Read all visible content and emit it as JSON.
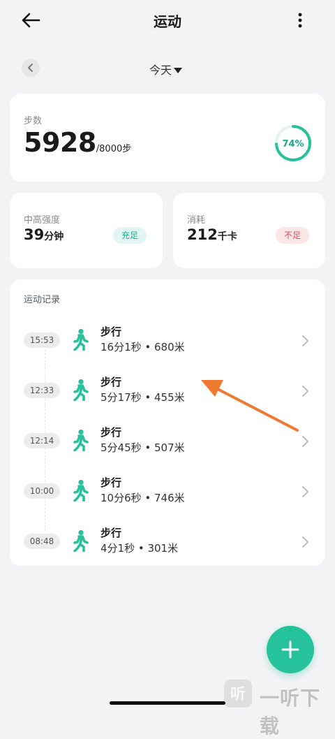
{
  "header": {
    "title": "运动"
  },
  "date": {
    "label": "今天"
  },
  "steps": {
    "label": "步数",
    "value": "5928",
    "goal": "/8000步",
    "percent_label": "74%",
    "percent": 0.74
  },
  "intensity": {
    "label": "中高强度",
    "value": "39",
    "unit": "分钟",
    "badge": "充足"
  },
  "energy": {
    "label": "消耗",
    "value": "212",
    "unit": "千卡",
    "badge": "不足"
  },
  "records": {
    "title": "运动记录",
    "items": [
      {
        "time": "15:53",
        "name": "步行",
        "detail": "16分1秒 • 680米"
      },
      {
        "time": "12:33",
        "name": "步行",
        "detail": "5分17秒 • 455米"
      },
      {
        "time": "12:14",
        "name": "步行",
        "detail": "5分45秒 • 507米"
      },
      {
        "time": "10:00",
        "name": "步行",
        "detail": "10分6秒 • 746米"
      },
      {
        "time": "08:48",
        "name": "步行",
        "detail": "4分1秒 • 301米"
      }
    ]
  },
  "watermark": {
    "text": "一听下载"
  },
  "colors": {
    "accent": "#26c29c",
    "badge_ok": "#1aaa90",
    "badge_low": "#d65050",
    "annotation_arrow": "#f07a30"
  },
  "icons": [
    "back-arrow-icon",
    "more-vertical-icon",
    "chevron-left-icon",
    "caret-down-icon",
    "walking-person-icon",
    "chevron-right-icon",
    "plus-icon"
  ]
}
